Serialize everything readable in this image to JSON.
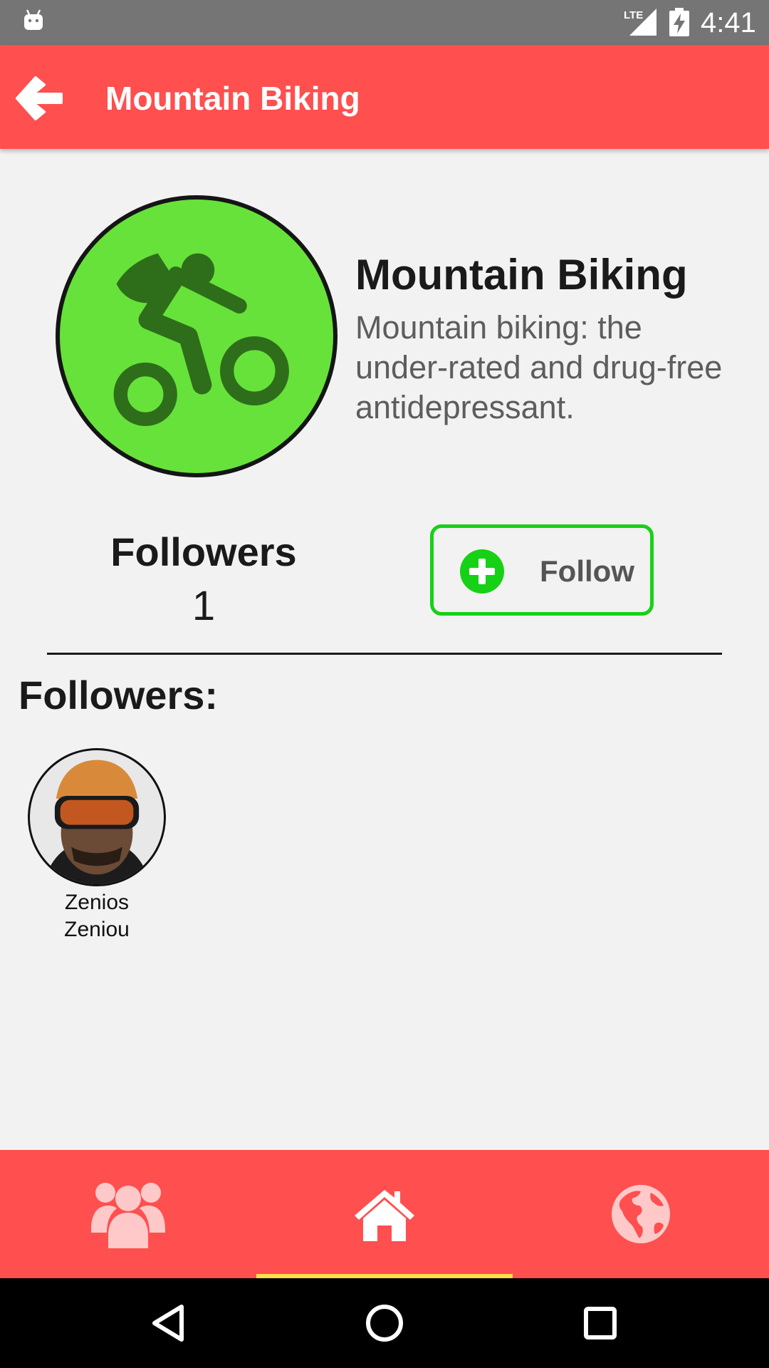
{
  "status_bar": {
    "network": "LTE",
    "time": "4:41"
  },
  "app_bar": {
    "title": "Mountain Biking"
  },
  "hero": {
    "title": "Mountain Biking",
    "description": "Mountain biking: the under-rated and drug-free antidepressant."
  },
  "stats": {
    "followers_label": "Followers",
    "followers_count": "1"
  },
  "follow_button": {
    "label": "Follow"
  },
  "followers_section": {
    "title": "Followers:",
    "items": [
      {
        "name": "Zenios Zeniou"
      }
    ]
  },
  "colors": {
    "status_bar": "#757575",
    "app_bar": "#ff4f4f",
    "logo_fill": "#67e23a",
    "logo_figure": "#2e6e1a",
    "follow_border": "#16d116",
    "nav_indicator": "#ffe04a",
    "nav_inactive_icon": "#ffc9c9",
    "nav_active_icon": "#ffffff"
  },
  "bottom_nav": {
    "items": [
      {
        "icon": "groups-icon",
        "active": false
      },
      {
        "icon": "home-icon",
        "active": true
      },
      {
        "icon": "globe-icon",
        "active": false
      }
    ]
  },
  "system_nav": {
    "icons": [
      "back-triangle-icon",
      "home-circle-icon",
      "recents-square-icon"
    ]
  }
}
